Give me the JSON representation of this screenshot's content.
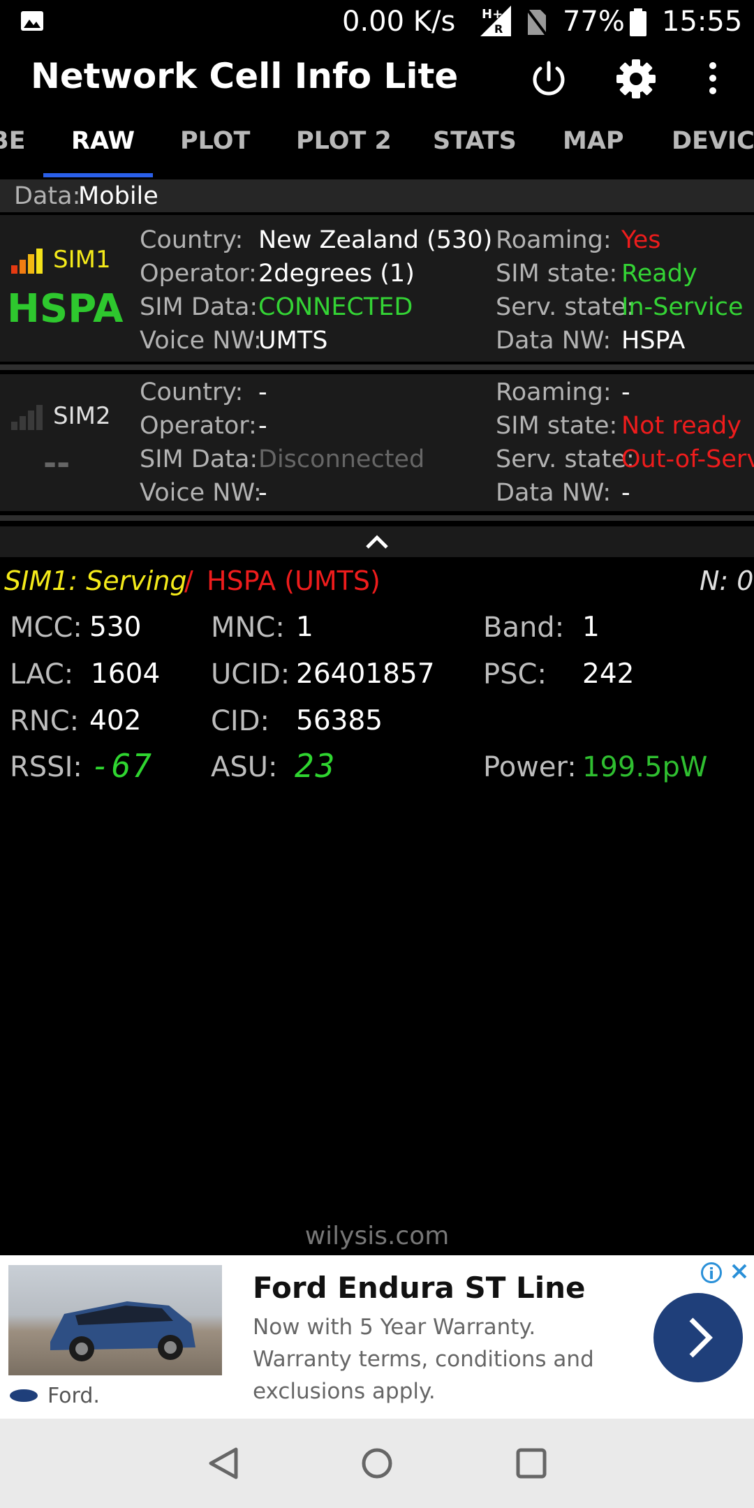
{
  "status_bar": {
    "speed": "0.00 K/s",
    "battery": "77%",
    "time": "15:55",
    "network_badge": "H+",
    "roaming_badge": "R"
  },
  "app": {
    "title": "Network Cell Info Lite"
  },
  "tabs": [
    {
      "label": "BE"
    },
    {
      "label": "RAW"
    },
    {
      "label": "PLOT"
    },
    {
      "label": "PLOT 2"
    },
    {
      "label": "STATS"
    },
    {
      "label": "MAP"
    },
    {
      "label": "DEVICE"
    }
  ],
  "data_row": {
    "label": "Data:",
    "value": "Mobile"
  },
  "sim1": {
    "name": "SIM1",
    "tech": "HSPA",
    "country_label": "Country:",
    "country": "New Zealand (530)",
    "operator_label": "Operator:",
    "operator": "2degrees (1)",
    "simdata_label": "SIM Data:",
    "simdata": "CONNECTED",
    "voice_label": "Voice NW:",
    "voice": "UMTS",
    "roaming_label": "Roaming:",
    "roaming": "Yes",
    "simstate_label": "SIM state:",
    "simstate": "Ready",
    "serv_label": "Serv. state:",
    "serv": "In-Service",
    "datanw_label": "Data NW:",
    "datanw": "HSPA"
  },
  "sim2": {
    "name": "SIM2",
    "tech": "--",
    "country_label": "Country:",
    "country": "-",
    "operator_label": "Operator:",
    "operator": "-",
    "simdata_label": "SIM Data:",
    "simdata": "Disconnected",
    "voice_label": "Voice NW:",
    "voice": "-",
    "roaming_label": "Roaming:",
    "roaming": "-",
    "simstate_label": "SIM state:",
    "simstate": "Not ready",
    "serv_label": "Serv. state:",
    "serv": "Out-of-Serv",
    "datanw_label": "Data NW:",
    "datanw": "-"
  },
  "serving": {
    "sim": "SIM1: Serving",
    "slash": "/",
    "tech": "HSPA (UMTS)",
    "neighbors": "N: 0",
    "mcc_label": "MCC:",
    "mcc": "530",
    "mnc_label": "MNC:",
    "mnc": "1",
    "band_label": "Band:",
    "band": "1",
    "lac_label": "LAC:",
    "lac": "1604",
    "ucid_label": "UCID:",
    "ucid": "26401857",
    "psc_label": "PSC:",
    "psc": "242",
    "rnc_label": "RNC:",
    "rnc": "402",
    "cid_label": "CID:",
    "cid": "56385",
    "rssi_label": "RSSI:",
    "rssi": "-67",
    "asu_label": "ASU:",
    "asu": "23",
    "power_label": "Power:",
    "power": "199.5pW"
  },
  "footer": {
    "site": "wilysis.com"
  },
  "ad": {
    "title": "Ford Endura ST Line",
    "body": "Now with 5 Year Warranty. Warranty terms, conditions and exclusions apply.",
    "advertiser": "Ford."
  },
  "colors": {
    "tab_indicator": "#2a5fe8",
    "red": "#ee1c1c",
    "green": "#34d435",
    "yellow": "#f4ea1a",
    "ad_button": "#1f3f7a"
  }
}
